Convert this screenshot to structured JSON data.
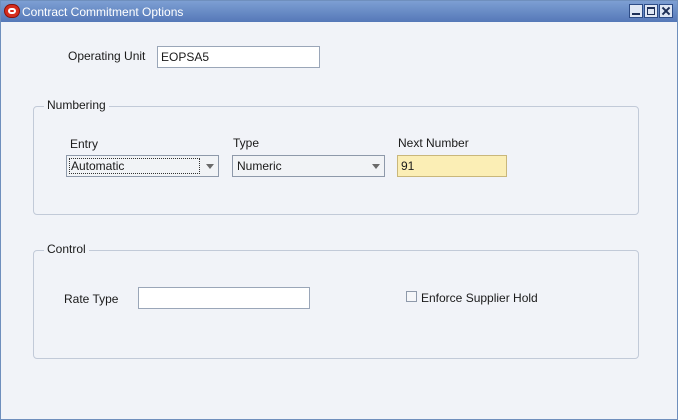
{
  "window": {
    "title": "Contract Commitment Options"
  },
  "operating_unit": {
    "label": "Operating Unit",
    "value": "EOPSA5"
  },
  "numbering": {
    "legend": "Numbering",
    "entry": {
      "label": "Entry",
      "value": "Automatic"
    },
    "type": {
      "label": "Type",
      "value": "Numeric"
    },
    "next_number": {
      "label": "Next Number",
      "value": "91"
    }
  },
  "control": {
    "legend": "Control",
    "rate_type": {
      "label": "Rate Type",
      "value": ""
    },
    "enforce_supplier_hold": {
      "label": "Enforce Supplier Hold",
      "checked": false
    }
  },
  "colors": {
    "titlebar": "#5578b8",
    "highlight_field": "#fbeeb5",
    "oracle_icon": "#d52d1e"
  }
}
